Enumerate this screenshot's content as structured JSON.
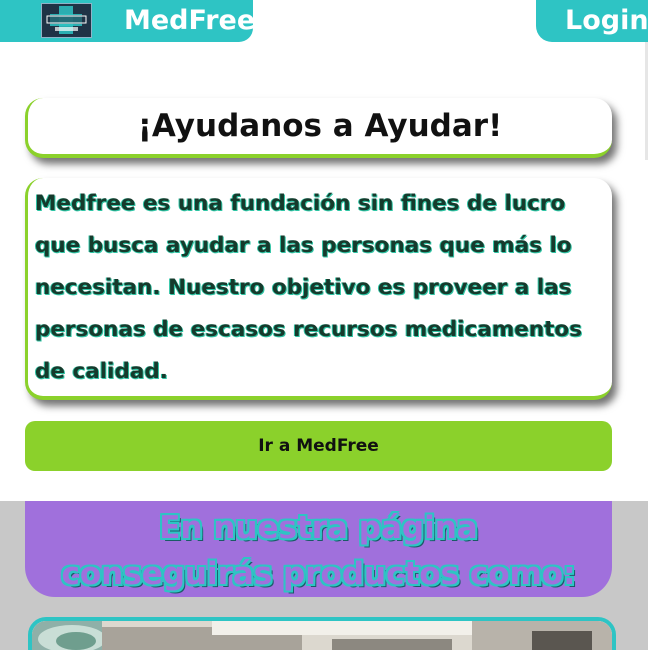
{
  "header": {
    "brand_name": "MedFree",
    "login_label": "Login",
    "logo_alt": "MedFree logo"
  },
  "hero": {
    "title": "¡Ayudanos a Ayudar!",
    "description": "Medfree es una fundación sin fines de lucro que busca ayudar a las personas que más lo necesitan. Nuestro objetivo es proveer a las personas de escasos recursos medicamentos de calidad.",
    "cta_label": "Ir a MedFree"
  },
  "promo": {
    "line1": "En nuestra página",
    "line2": "conseguirás productos como:"
  },
  "colors": {
    "teal": "#2ec4c4",
    "green": "#8bd12b",
    "purple": "#a070dc",
    "grey": "#c8c8c8"
  },
  "icons": {
    "logo": "medfree-cross-logo-icon"
  }
}
